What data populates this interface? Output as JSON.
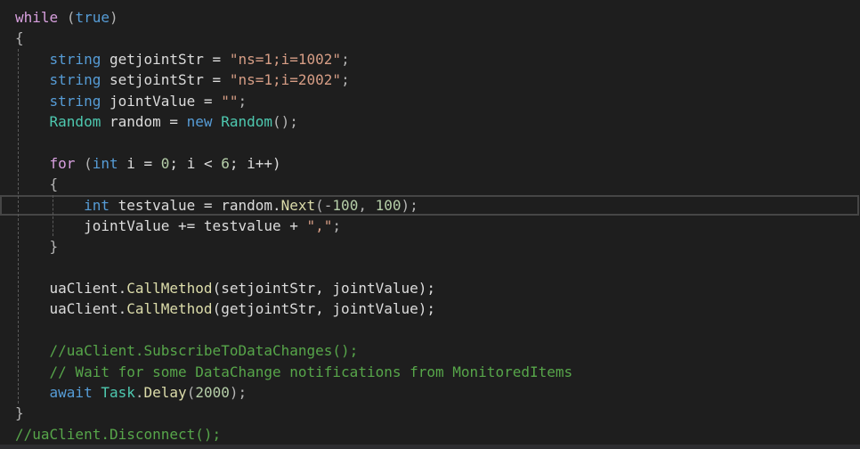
{
  "editor": {
    "lines": [
      {
        "indent": 0,
        "tokens": [
          {
            "t": "while",
            "c": "control"
          },
          {
            "t": " ",
            "c": "ident"
          },
          {
            "t": "(",
            "c": "punct"
          },
          {
            "t": "true",
            "c": "keyword"
          },
          {
            "t": ")",
            "c": "punct"
          }
        ]
      },
      {
        "indent": 0,
        "tokens": [
          {
            "t": "{",
            "c": "punct"
          }
        ]
      },
      {
        "indent": 1,
        "tokens": [
          {
            "t": "string",
            "c": "keyword"
          },
          {
            "t": " getjointStr = ",
            "c": "ident"
          },
          {
            "t": "\"ns=1;i=1002\"",
            "c": "string"
          },
          {
            "t": ";",
            "c": "punct"
          }
        ]
      },
      {
        "indent": 1,
        "tokens": [
          {
            "t": "string",
            "c": "keyword"
          },
          {
            "t": " setjointStr = ",
            "c": "ident"
          },
          {
            "t": "\"ns=1;i=2002\"",
            "c": "string"
          },
          {
            "t": ";",
            "c": "punct"
          }
        ]
      },
      {
        "indent": 1,
        "tokens": [
          {
            "t": "string",
            "c": "keyword"
          },
          {
            "t": " jointValue = ",
            "c": "ident"
          },
          {
            "t": "\"\"",
            "c": "string"
          },
          {
            "t": ";",
            "c": "punct"
          }
        ]
      },
      {
        "indent": 1,
        "tokens": [
          {
            "t": "Random",
            "c": "type"
          },
          {
            "t": " random = ",
            "c": "ident"
          },
          {
            "t": "new",
            "c": "keyword"
          },
          {
            "t": " ",
            "c": "ident"
          },
          {
            "t": "Random",
            "c": "type"
          },
          {
            "t": "();",
            "c": "punct"
          }
        ]
      },
      {
        "indent": 1,
        "tokens": []
      },
      {
        "indent": 1,
        "tokens": [
          {
            "t": "for",
            "c": "control"
          },
          {
            "t": " (",
            "c": "punct"
          },
          {
            "t": "int",
            "c": "keyword"
          },
          {
            "t": " i = ",
            "c": "ident"
          },
          {
            "t": "0",
            "c": "number"
          },
          {
            "t": "; i < ",
            "c": "ident"
          },
          {
            "t": "6",
            "c": "number"
          },
          {
            "t": "; i++)",
            "c": "ident"
          }
        ]
      },
      {
        "indent": 1,
        "tokens": [
          {
            "t": "{",
            "c": "punct"
          }
        ]
      },
      {
        "indent": 2,
        "current": true,
        "tokens": [
          {
            "t": "int",
            "c": "keyword"
          },
          {
            "t": " testvalue = random.",
            "c": "ident"
          },
          {
            "t": "Next",
            "c": "method"
          },
          {
            "t": "(-",
            "c": "punct"
          },
          {
            "t": "100",
            "c": "number"
          },
          {
            "t": ", ",
            "c": "punct"
          },
          {
            "t": "100",
            "c": "number"
          },
          {
            "t": ");",
            "c": "punct"
          }
        ]
      },
      {
        "indent": 2,
        "tokens": [
          {
            "t": "jointValue += testvalue + ",
            "c": "ident"
          },
          {
            "t": "\",\"",
            "c": "string"
          },
          {
            "t": ";",
            "c": "punct"
          }
        ]
      },
      {
        "indent": 1,
        "tokens": [
          {
            "t": "}",
            "c": "punct"
          }
        ]
      },
      {
        "indent": 1,
        "tokens": []
      },
      {
        "indent": 1,
        "tokens": [
          {
            "t": "uaClient.",
            "c": "ident"
          },
          {
            "t": "CallMethod",
            "c": "method"
          },
          {
            "t": "(setjointStr, jointValue);",
            "c": "ident"
          }
        ]
      },
      {
        "indent": 1,
        "tokens": [
          {
            "t": "uaClient.",
            "c": "ident"
          },
          {
            "t": "CallMethod",
            "c": "method"
          },
          {
            "t": "(getjointStr, jointValue);",
            "c": "ident"
          }
        ]
      },
      {
        "indent": 1,
        "tokens": []
      },
      {
        "indent": 1,
        "tokens": [
          {
            "t": "//uaClient.SubscribeToDataChanges();",
            "c": "comment"
          }
        ]
      },
      {
        "indent": 1,
        "tokens": [
          {
            "t": "// Wait for some DataChange notifications from MonitoredItems",
            "c": "comment"
          }
        ]
      },
      {
        "indent": 1,
        "tokens": [
          {
            "t": "await",
            "c": "keyword"
          },
          {
            "t": " ",
            "c": "ident"
          },
          {
            "t": "Task",
            "c": "type"
          },
          {
            "t": ".",
            "c": "punct"
          },
          {
            "t": "Delay",
            "c": "method"
          },
          {
            "t": "(",
            "c": "punct"
          },
          {
            "t": "2000",
            "c": "number"
          },
          {
            "t": ");",
            "c": "punct"
          }
        ]
      },
      {
        "indent": 0,
        "tokens": [
          {
            "t": "}",
            "c": "punct"
          }
        ]
      },
      {
        "indent": 0,
        "tokens": [
          {
            "t": "//uaClient.Disconnect();",
            "c": "comment"
          }
        ]
      }
    ]
  }
}
